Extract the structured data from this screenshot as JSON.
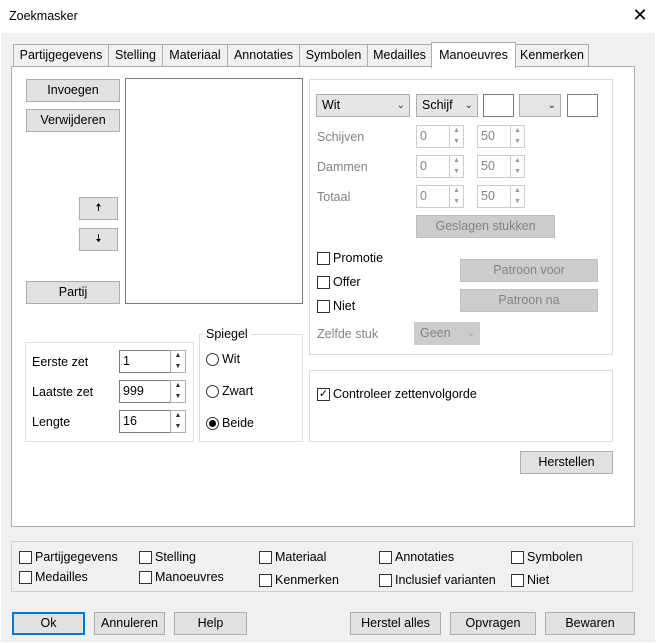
{
  "window": {
    "title": "Zoekmasker",
    "close_glyph": "✕"
  },
  "tabs": [
    {
      "label": "Partijgegevens"
    },
    {
      "label": "Stelling"
    },
    {
      "label": "Materiaal"
    },
    {
      "label": "Annotaties"
    },
    {
      "label": "Symbolen"
    },
    {
      "label": "Medailles"
    },
    {
      "label": "Manoeuvres",
      "active": true
    },
    {
      "label": "Kenmerken"
    }
  ],
  "left": {
    "invoegen": "Invoegen",
    "verwijderen": "Verwijderen",
    "up_glyph": "🠅",
    "down_glyph": "🠇",
    "partij": "Partij"
  },
  "range": {
    "eerste_label": "Eerste zet",
    "eerste_value": "1",
    "laatste_label": "Laatste zet",
    "laatste_value": "999",
    "lengte_label": "Lengte",
    "lengte_value": "16"
  },
  "spiegel": {
    "title": "Spiegel",
    "options": [
      {
        "label": "Wit",
        "checked": false
      },
      {
        "label": "Zwart",
        "checked": false
      },
      {
        "label": "Beide",
        "checked": true
      }
    ]
  },
  "right": {
    "color_select": "Wit",
    "piece_select": "Schijf",
    "small_select": "",
    "schijven_label": "Schijven",
    "schijven_min": "0",
    "schijven_max": "50",
    "dammen_label": "Dammen",
    "dammen_min": "0",
    "dammen_max": "50",
    "totaal_label": "Totaal",
    "totaal_min": "0",
    "totaal_max": "50",
    "geslagen": "Geslagen stukken",
    "promotie": "Promotie",
    "offer": "Offer",
    "niet": "Niet",
    "patroon_voor": "Patroon voor",
    "patroon_na": "Patroon na",
    "zelfde_label": "Zelfde stuk",
    "zelfde_value": "Geen"
  },
  "controleer": {
    "label": "Controleer zettenvolgorde",
    "checked": true
  },
  "herstellen": "Herstellen",
  "bottom_checks": [
    {
      "label": "Partijgegevens",
      "checked": false
    },
    {
      "label": "Stelling",
      "checked": false
    },
    {
      "label": "Materiaal",
      "checked": false
    },
    {
      "label": "Annotaties",
      "checked": false
    },
    {
      "label": "Symbolen",
      "checked": false
    },
    {
      "label": "Medailles",
      "checked": false
    },
    {
      "label": "Manoeuvres",
      "checked": false
    },
    {
      "label": "Kenmerken",
      "checked": false
    },
    {
      "label": "Inclusief varianten",
      "checked": false
    },
    {
      "label": "Niet",
      "checked": false
    }
  ],
  "footer": {
    "ok": "Ok",
    "annuleren": "Annuleren",
    "help": "Help",
    "herstel_alles": "Herstel alles",
    "opvragen": "Opvragen",
    "bewaren": "Bewaren"
  },
  "icons": {
    "checkmark": "✓",
    "spin_up": "▲",
    "spin_down": "▼",
    "dropdown": "⌄"
  }
}
